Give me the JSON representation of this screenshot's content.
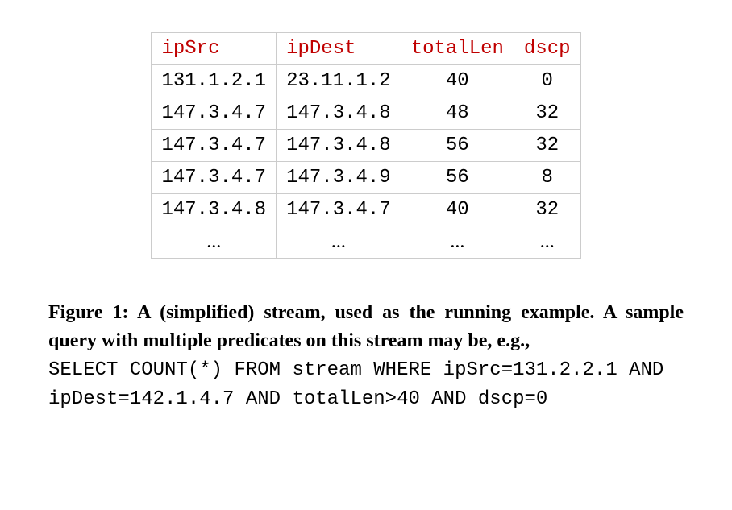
{
  "chart_data": {
    "type": "table",
    "columns": [
      "ipSrc",
      "ipDest",
      "totalLen",
      "dscp"
    ],
    "rows": [
      {
        "ipSrc": "131.1.2.1",
        "ipDest": "23.11.1.2",
        "totalLen": "40",
        "dscp": "0"
      },
      {
        "ipSrc": "147.3.4.7",
        "ipDest": "147.3.4.8",
        "totalLen": "48",
        "dscp": "32"
      },
      {
        "ipSrc": "147.3.4.7",
        "ipDest": "147.3.4.8",
        "totalLen": "56",
        "dscp": "32"
      },
      {
        "ipSrc": "147.3.4.7",
        "ipDest": "147.3.4.9",
        "totalLen": "56",
        "dscp": "8"
      },
      {
        "ipSrc": "147.3.4.8",
        "ipDest": "147.3.4.7",
        "totalLen": "40",
        "dscp": "32"
      }
    ],
    "ellipsis": "..."
  },
  "caption": {
    "lead_bold": "Figure 1: A (simplified) stream, used as the running example. A sample query with multiple predicates on this stream may be, e.g.,",
    "query_line1": "SELECT COUNT(*) FROM stream WHERE ipSrc=131.2.2.1 AND",
    "query_line2": "ipDest=142.1.4.7 AND totalLen>40 AND dscp=0"
  }
}
